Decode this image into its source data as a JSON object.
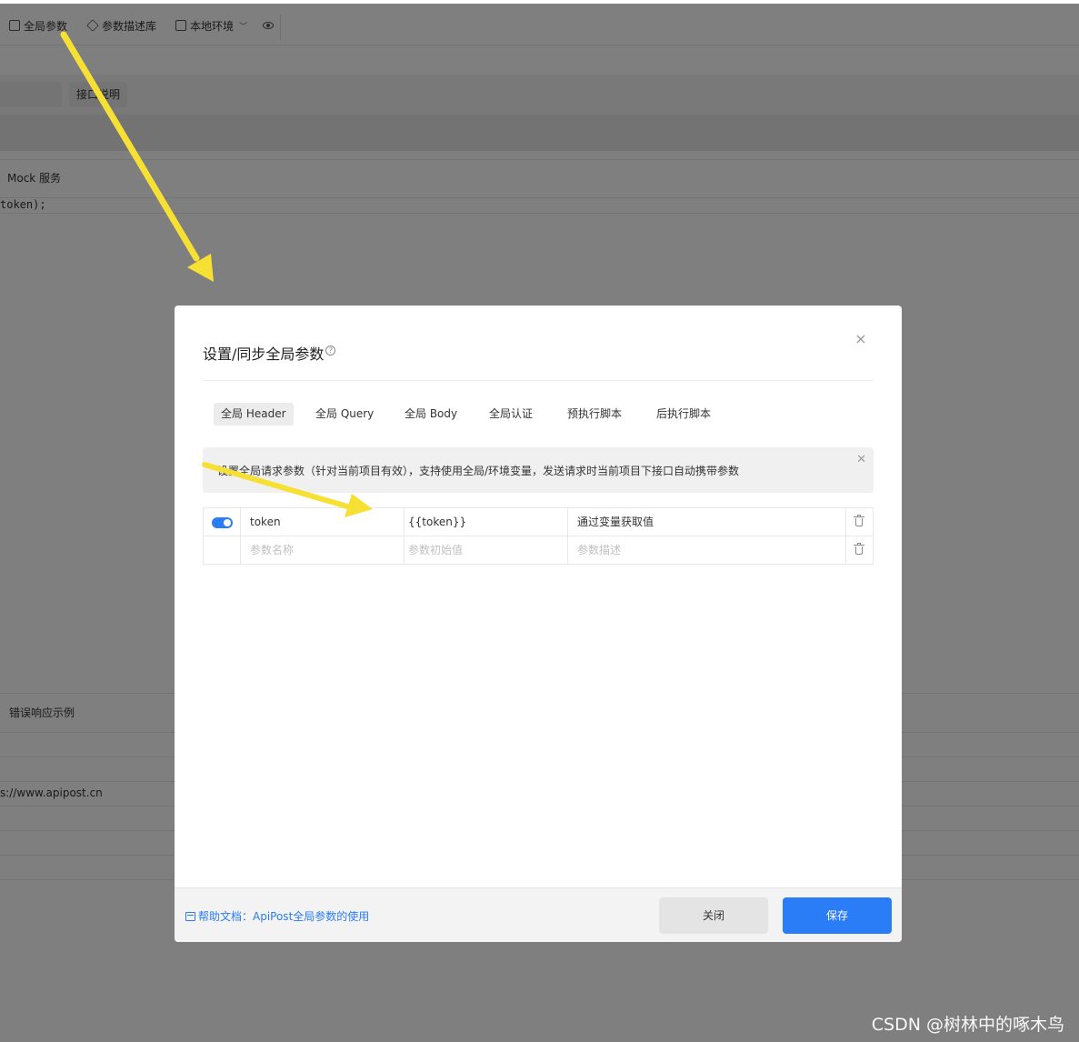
{
  "toolbar": {
    "global_params": "全局参数",
    "param_library": "参数描述库",
    "environment": "本地环境",
    "env_dropdown_icon": "chevron-down-icon",
    "preview_icon": "eye-icon"
  },
  "background": {
    "api_desc_button": "接口说明",
    "mock_service": "Mock 服务",
    "code_snippet": "token);",
    "error_example": "错误响应示例",
    "url_fragment": "s://www.apipost.cn"
  },
  "modal": {
    "title": "设置/同步全局参数",
    "tabs": [
      {
        "label": "全局 Header",
        "active": true
      },
      {
        "label": "全局 Query",
        "active": false
      },
      {
        "label": "全局 Body",
        "active": false
      },
      {
        "label": "全局认证",
        "active": false
      },
      {
        "label": "预执行脚本",
        "active": false
      },
      {
        "label": "后执行脚本",
        "active": false
      }
    ],
    "notice": "设置全局请求参数（针对当前项目有效），支持使用全局/环境变量，发送请求时当前项目下接口自动携带参数",
    "rows": [
      {
        "enabled": true,
        "name": "token",
        "value": "{{token}}",
        "description": "通过变量获取值"
      }
    ],
    "new_row_placeholders": {
      "name": "参数名称",
      "value": "参数初始值",
      "description": "参数描述"
    },
    "footer": {
      "help_link": "帮助文档：ApiPost全局参数的使用",
      "close_button": "关闭",
      "save_button": "保存"
    }
  },
  "watermark": "CSDN @树林中的啄木鸟",
  "colors": {
    "primary": "#2a7cf7",
    "annotation_arrow": "#f7e034"
  }
}
